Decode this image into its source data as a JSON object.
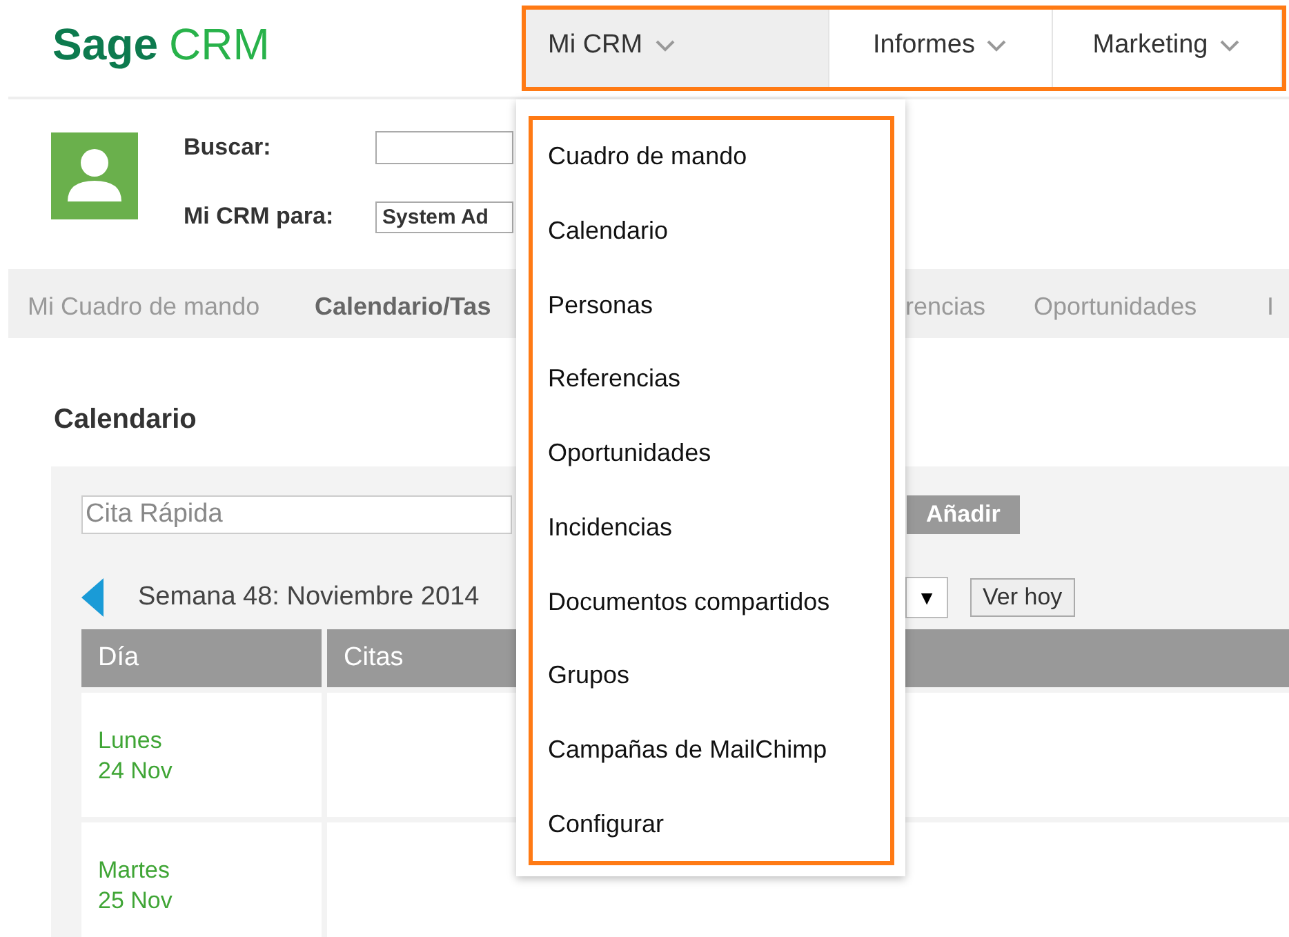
{
  "logo": {
    "brand": "Sage",
    "product": "CRM"
  },
  "nav": [
    {
      "label": "Mi CRM",
      "selected": true
    },
    {
      "label": "Informes",
      "selected": false
    },
    {
      "label": "Marketing",
      "selected": false
    }
  ],
  "user": {
    "search_label": "Buscar:",
    "for_label": "Mi CRM para:",
    "for_value": "System Ad"
  },
  "tabs": [
    {
      "label": "Mi Cuadro de mando",
      "selected": false
    },
    {
      "label": "Calendario/Tas",
      "selected": true
    },
    {
      "label": "rencias",
      "selected": false
    },
    {
      "label": "Oportunidades",
      "selected": false
    },
    {
      "label": "I",
      "selected": false
    }
  ],
  "calendar": {
    "title": "Calendario",
    "quick_entry": "Cita Rápida",
    "add_button": "Añadir",
    "week": "Semana 48: Noviembre 2014",
    "view_select": "▼",
    "today_button": "Ver hoy",
    "columns": [
      "Día",
      "Citas"
    ],
    "days": [
      {
        "name": "Lunes",
        "date": "24 Nov"
      },
      {
        "name": "Martes",
        "date": "25 Nov"
      }
    ]
  },
  "menu": {
    "items": [
      "Cuadro de mando",
      "Calendario",
      "Personas",
      "Referencias",
      "Oportunidades",
      "Incidencias",
      "Documentos compartidos",
      "Grupos",
      "Campañas de MailChimp",
      "Configurar"
    ]
  }
}
